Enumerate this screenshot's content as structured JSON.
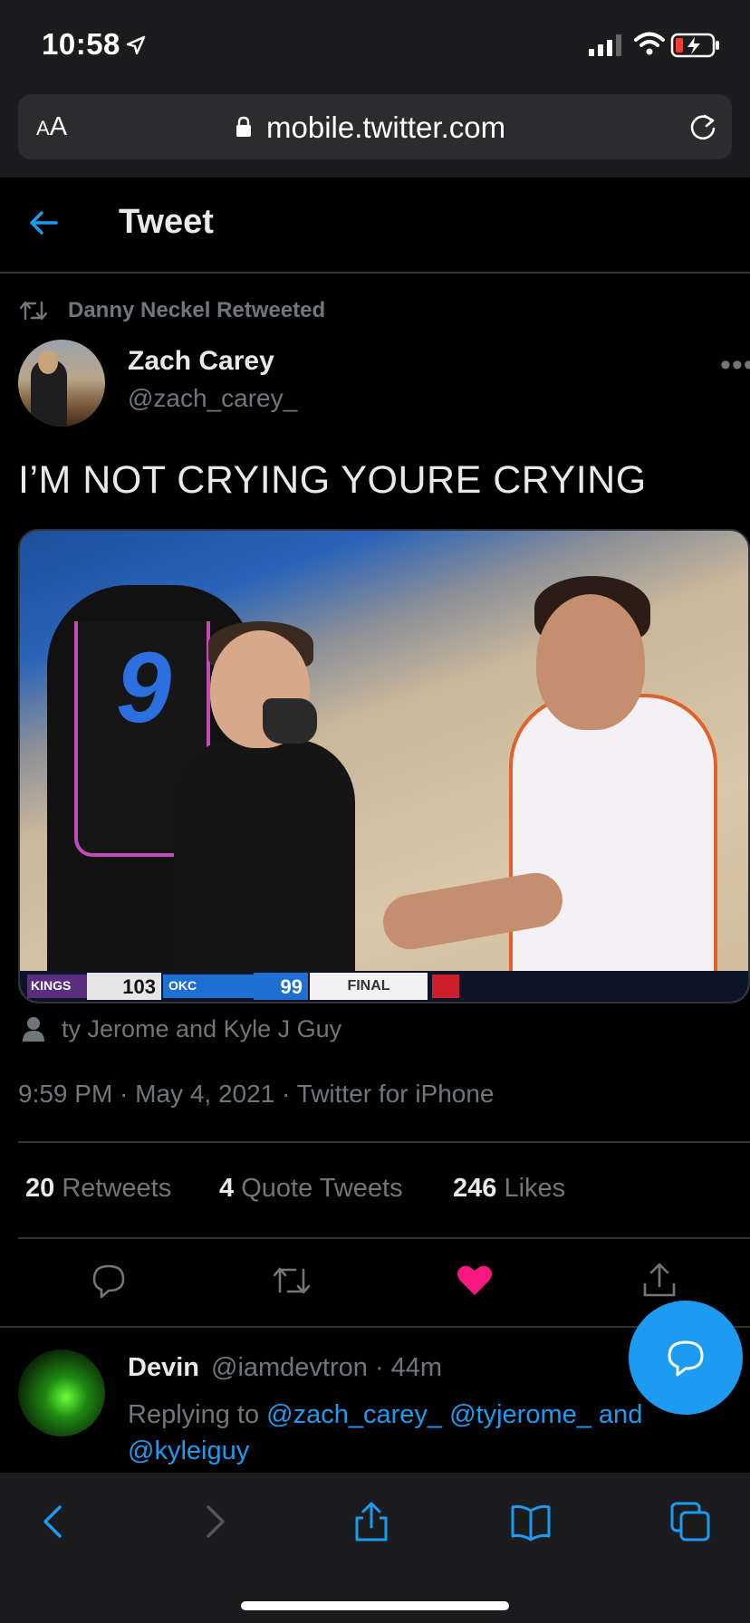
{
  "status_bar": {
    "time": "10:58",
    "icons": [
      "location-arrow-icon",
      "cellular-signal-icon",
      "wifi-icon",
      "battery-charging-icon"
    ],
    "battery_color": "#ff3b30"
  },
  "browser": {
    "text_size_label_small": "A",
    "text_size_label_large": "A",
    "url": "mobile.twitter.com",
    "toolbar_icons": [
      "back-icon",
      "forward-icon",
      "share-icon",
      "bookmarks-icon",
      "tabs-icon"
    ]
  },
  "header": {
    "title": "Tweet"
  },
  "tweet": {
    "retweeted_by": "Danny Neckel Retweeted",
    "author_name": "Zach Carey",
    "author_handle": "@zach_carey_",
    "text": "I’M NOT CRYING YOURE CRYING",
    "media": {
      "scoreboard": {
        "team1": "KINGS",
        "score1": "103",
        "team2": "OKC",
        "score2": "99",
        "status": "FINAL"
      }
    },
    "tagged": "ty Jerome and Kyle J Guy",
    "timestamp": "9:59 PM · May 4, 2021 · Twitter for iPhone",
    "stats": {
      "retweets_count": "20",
      "retweets_label": "Retweets",
      "quotes_count": "4",
      "quotes_label": "Quote Tweets",
      "likes_count": "246",
      "likes_label": "Likes"
    },
    "liked": true
  },
  "reply": {
    "name": "Devin",
    "meta": "@iamdevtron · 44m",
    "replying_prefix": "Replying to ",
    "mention1": "@zach_carey_",
    "mention2": "@tyjerome_",
    "and": " and",
    "mention3": "@kyleiguy"
  },
  "colors": {
    "accent": "#1d9bf0",
    "like": "#f91880",
    "muted": "#71767b"
  }
}
